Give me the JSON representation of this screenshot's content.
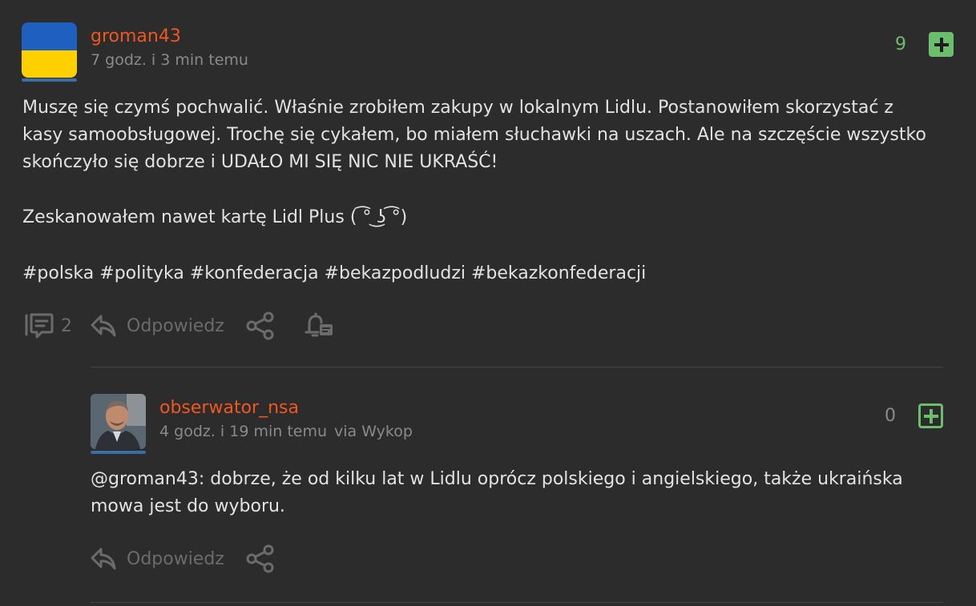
{
  "post": {
    "author": "groman43",
    "time": "7 godz. i 3 min temu",
    "votes": "9",
    "body_lines": [
      "Muszę się czymś pochwalić. Właśnie zrobiłem zakupy w lokalnym Lidlu. Postanowiłem skorzystać z",
      "kasy samoobsługowej. Trochę się cykałem, bo miałem słuchawki na uszach. Ale na szczęście wszystko",
      "skończyło się dobrze i UDAŁO MI SIĘ NIC NIE UKRAŚĆ!"
    ],
    "body_line2": "Zeskanowałem nawet kartę Lidl Plus ( ͡° ͜ʖ ͡°)",
    "tags": "#polska #polityka #konfederacja #bekazpodludzi #bekazkonfederacji",
    "comments_count": "2",
    "reply_label": "Odpowiedz",
    "accent_color": "#f0561f",
    "vote_color": "#6bbe6b"
  },
  "reply": {
    "author": "obserwator_nsa",
    "time": "4 godz. i 19 min temu",
    "via": "via Wykop",
    "votes": "0",
    "mention": "@groman43",
    "body_rest": ": dobrze, że od kilku lat w Lidlu oprócz polskiego i angielskiego, także ukraińska",
    "body_line2": "mowa jest do wyboru.",
    "reply_label": "Odpowiedz"
  }
}
